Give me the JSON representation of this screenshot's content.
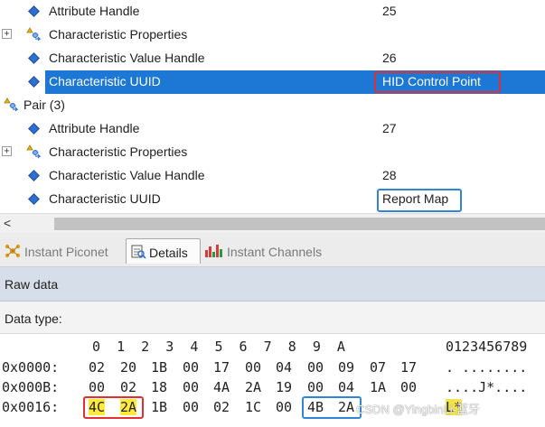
{
  "tree": {
    "rows": [
      {
        "label": "Attribute Handle",
        "value": "25"
      },
      {
        "label": "Characteristic Properties",
        "value": ""
      },
      {
        "label": "Characteristic Value Handle",
        "value": "26"
      },
      {
        "label": "Characteristic UUID",
        "value": "HID Control Point"
      },
      {
        "label": "Pair (3)",
        "value": ""
      },
      {
        "label": "Attribute Handle",
        "value": "27"
      },
      {
        "label": "Characteristic Properties",
        "value": ""
      },
      {
        "label": "Characteristic Value Handle",
        "value": "28"
      },
      {
        "label": "Characteristic UUID",
        "value": "Report Map"
      }
    ],
    "expander_symbol": "+"
  },
  "scrollbar": {
    "left_arrow": "<"
  },
  "tabs": [
    {
      "label": "Instant Piconet",
      "active": false
    },
    {
      "label": "Details",
      "active": true
    },
    {
      "label": "Instant Channels",
      "active": false
    }
  ],
  "panels": {
    "raw_data": "Raw data",
    "data_type": "Data type:"
  },
  "hex": {
    "column_header": "0  1  2  3  4  5  6  7  8  9  A",
    "ascii_header": "0123456789",
    "rows": [
      {
        "offset": "0x0000:",
        "bytes": [
          "02",
          "20",
          "1B",
          "00",
          "17",
          "00",
          "04",
          "00",
          "09",
          "07",
          "17"
        ],
        "ascii": ". ........"
      },
      {
        "offset": "0x000B:",
        "bytes": [
          "00",
          "02",
          "18",
          "00",
          "4A",
          "2A",
          "19",
          "00",
          "04",
          "1A",
          "00"
        ],
        "ascii": "....J*...."
      },
      {
        "offset": "0x0016:",
        "bytes": [
          "4C",
          "2A",
          "1B",
          "00",
          "02",
          "1C",
          "00",
          "4B",
          "2A"
        ],
        "ascii": "L*"
      }
    ]
  },
  "watermark": "CSDN @YingbinLi-蓝牙",
  "colors": {
    "selection": "#1c78d4",
    "highlight_red": "#e03030",
    "highlight_blue": "#2f86d6",
    "raw_data_bg": "#d5dee9"
  }
}
